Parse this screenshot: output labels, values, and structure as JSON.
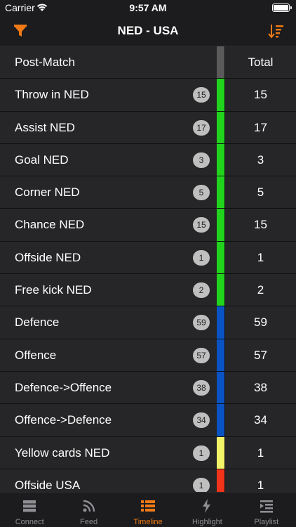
{
  "status_bar": {
    "carrier": "Carrier",
    "time": "9:57 AM"
  },
  "nav": {
    "title": "NED - USA",
    "filter_icon": "filter-icon",
    "sort_icon": "sort-icon"
  },
  "colors": {
    "accent": "#f07a16",
    "gray": "#5a5a5a",
    "green": "#22d31d",
    "blue": "#0a53c2",
    "yellow": "#f4f46a",
    "red": "#f3341a"
  },
  "table": {
    "header": {
      "label": "Post-Match",
      "total": "Total"
    },
    "rows": [
      {
        "label": "Throw in NED",
        "count": "15",
        "total": "15",
        "color": "#22d31d"
      },
      {
        "label": "Assist NED",
        "count": "17",
        "total": "17",
        "color": "#22d31d"
      },
      {
        "label": "Goal NED",
        "count": "3",
        "total": "3",
        "color": "#22d31d"
      },
      {
        "label": "Corner NED",
        "count": "5",
        "total": "5",
        "color": "#22d31d"
      },
      {
        "label": "Chance NED",
        "count": "15",
        "total": "15",
        "color": "#22d31d"
      },
      {
        "label": "Offside NED",
        "count": "1",
        "total": "1",
        "color": "#22d31d"
      },
      {
        "label": "Free kick NED",
        "count": "2",
        "total": "2",
        "color": "#22d31d"
      },
      {
        "label": "Defence",
        "count": "59",
        "total": "59",
        "color": "#0a53c2"
      },
      {
        "label": "Offence",
        "count": "57",
        "total": "57",
        "color": "#0a53c2"
      },
      {
        "label": "Defence->Offence",
        "count": "38",
        "total": "38",
        "color": "#0a53c2"
      },
      {
        "label": "Offence->Defence",
        "count": "34",
        "total": "34",
        "color": "#0a53c2"
      },
      {
        "label": "Yellow cards NED",
        "count": "1",
        "total": "1",
        "color": "#f4f46a"
      },
      {
        "label": "Offside USA",
        "count": "1",
        "total": "1",
        "color": "#f3341a"
      }
    ]
  },
  "tabs": [
    {
      "label": "Connect",
      "icon": "server-icon",
      "active": false
    },
    {
      "label": "Feed",
      "icon": "rss-icon",
      "active": false
    },
    {
      "label": "Timeline",
      "icon": "list-icon",
      "active": true
    },
    {
      "label": "Highlight",
      "icon": "bolt-icon",
      "active": false
    },
    {
      "label": "Playlist",
      "icon": "playlist-icon",
      "active": false
    }
  ]
}
